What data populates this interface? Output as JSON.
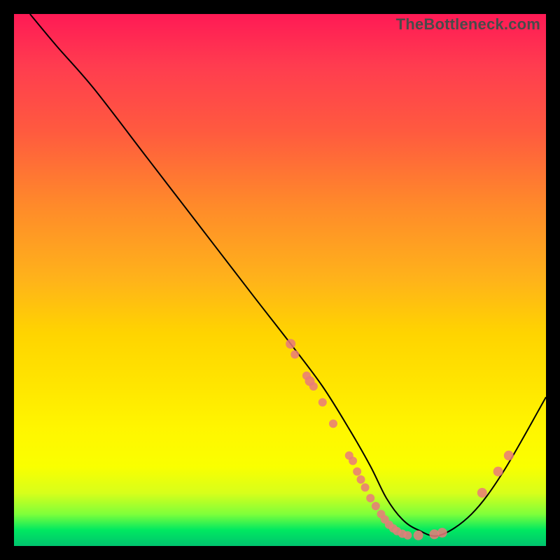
{
  "watermark": "TheBottleneck.com",
  "colors": {
    "dot": "#e97a7a",
    "curve": "#000000",
    "background_frame": "#000000"
  },
  "chart_data": {
    "type": "line",
    "title": "",
    "xlabel": "",
    "ylabel": "",
    "xlim": [
      0,
      100
    ],
    "ylim": [
      0,
      100
    ],
    "grid": false,
    "legend": false,
    "series": [
      {
        "name": "bottleneck-curve",
        "x": [
          3,
          8,
          15,
          25,
          35,
          45,
          52,
          58,
          63,
          67,
          70,
          73,
          76,
          80,
          86,
          92,
          100
        ],
        "y": [
          100,
          94,
          86,
          73,
          60,
          47,
          38,
          30,
          22,
          15,
          9,
          5,
          3,
          2,
          6,
          14,
          28
        ]
      }
    ],
    "markers": [
      {
        "x": 52,
        "y": 38,
        "r": 7
      },
      {
        "x": 52.8,
        "y": 36,
        "r": 6
      },
      {
        "x": 55,
        "y": 32,
        "r": 6
      },
      {
        "x": 55.6,
        "y": 31,
        "r": 7
      },
      {
        "x": 56.3,
        "y": 30,
        "r": 6
      },
      {
        "x": 58,
        "y": 27,
        "r": 6
      },
      {
        "x": 60,
        "y": 23,
        "r": 6
      },
      {
        "x": 63,
        "y": 17,
        "r": 6
      },
      {
        "x": 63.7,
        "y": 16,
        "r": 6
      },
      {
        "x": 64.5,
        "y": 14,
        "r": 6
      },
      {
        "x": 65.2,
        "y": 12.5,
        "r": 6
      },
      {
        "x": 66,
        "y": 11,
        "r": 6
      },
      {
        "x": 67,
        "y": 9,
        "r": 6
      },
      {
        "x": 68,
        "y": 7.5,
        "r": 6
      },
      {
        "x": 69,
        "y": 6,
        "r": 6
      },
      {
        "x": 69.7,
        "y": 5,
        "r": 6
      },
      {
        "x": 70.5,
        "y": 4,
        "r": 6
      },
      {
        "x": 71.3,
        "y": 3.3,
        "r": 6
      },
      {
        "x": 72,
        "y": 2.8,
        "r": 6
      },
      {
        "x": 73,
        "y": 2.3,
        "r": 6
      },
      {
        "x": 74,
        "y": 2,
        "r": 6
      },
      {
        "x": 76,
        "y": 2,
        "r": 7
      },
      {
        "x": 79,
        "y": 2.2,
        "r": 7
      },
      {
        "x": 80.5,
        "y": 2.5,
        "r": 7
      },
      {
        "x": 88,
        "y": 10,
        "r": 7
      },
      {
        "x": 91,
        "y": 14,
        "r": 7
      },
      {
        "x": 93,
        "y": 17,
        "r": 7
      }
    ]
  }
}
